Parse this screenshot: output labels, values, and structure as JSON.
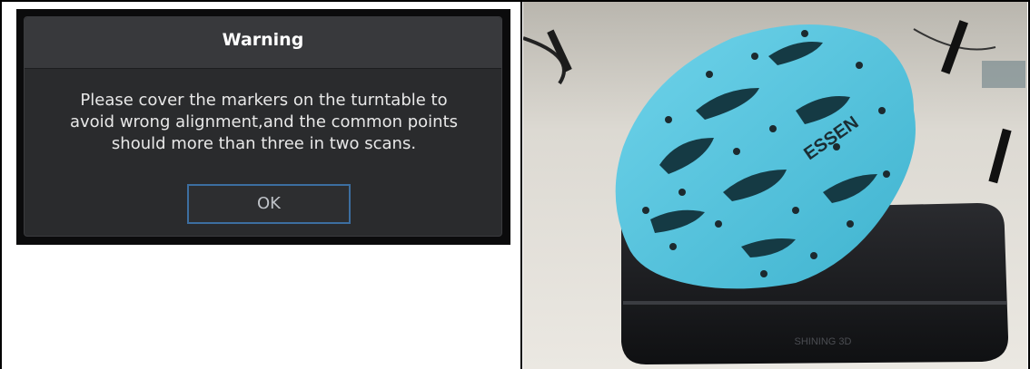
{
  "dialog": {
    "title": "Warning",
    "message_lines": [
      "Please cover the markers on the turntable to",
      "avoid wrong alignment,and the common points",
      "should more than three in two scans."
    ],
    "ok_label": "OK"
  },
  "photo": {
    "subject": "cyan bike helmet with marker dots on a black turntable",
    "helmet_logo": "ESSEN",
    "turntable_label": "SHINING 3D",
    "colors": {
      "helmet": "#4cc3dc",
      "turntable": "#1a1b1e",
      "table": "#e4e1da",
      "backdrop": "#bfbcb5"
    }
  }
}
